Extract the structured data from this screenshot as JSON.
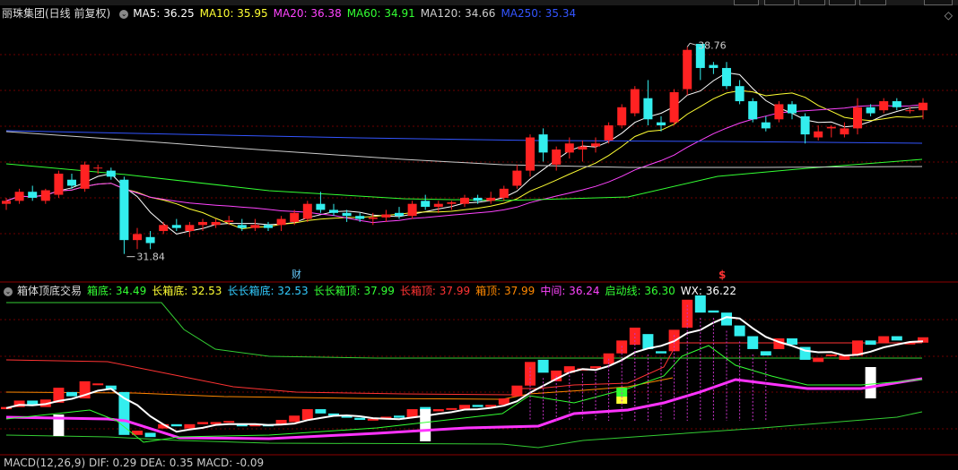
{
  "title": "丽珠集团(日线 前复权)",
  "ma_legend": [
    {
      "label": "MA5:",
      "value": "36.25",
      "color": "#ffffff"
    },
    {
      "label": "MA10:",
      "value": "35.95",
      "color": "#ffff33"
    },
    {
      "label": "MA20:",
      "value": "36.38",
      "color": "#ff44ff"
    },
    {
      "label": "MA60:",
      "value": "34.91",
      "color": "#33ff33"
    },
    {
      "label": "MA120:",
      "value": "34.66",
      "color": "#cccccc"
    },
    {
      "label": "MA250:",
      "value": "35.34",
      "color": "#3355ff"
    }
  ],
  "high_label": "38.76",
  "low_label": "31.84",
  "event_markers": [
    {
      "text": "财",
      "color": "#66ccff"
    },
    {
      "text": "$",
      "color": "#ff3333"
    }
  ],
  "indicator": {
    "name": "箱体顶底交易",
    "fields": [
      {
        "label": "箱底:",
        "value": "34.49",
        "color": "#33ff33"
      },
      {
        "label": "长箱底:",
        "value": "32.53",
        "color": "#ffff33"
      },
      {
        "label": "长长箱底:",
        "value": "32.53",
        "color": "#33ccff"
      },
      {
        "label": "长长箱顶:",
        "value": "37.99",
        "color": "#33ff33"
      },
      {
        "label": "长箱顶:",
        "value": "37.99",
        "color": "#ff3333"
      },
      {
        "label": "箱顶:",
        "value": "37.99",
        "color": "#ff8800"
      },
      {
        "label": "中间:",
        "value": "36.24",
        "color": "#ff44ff"
      },
      {
        "label": "启动线:",
        "value": "36.30",
        "color": "#33ff33"
      },
      {
        "label": "WX:",
        "value": "36.22",
        "color": "#ffffff"
      }
    ]
  },
  "macd_legend": "MACD(12,26,9) DIF: 0.29 DEA: 0.35 MACD: -0.09",
  "colors": {
    "up": "#ff2222",
    "down": "#33eeee",
    "divider": "#8b0000"
  },
  "chart_data": {
    "type": "candlestick",
    "y_range": [
      31.0,
      39.6
    ],
    "candles": [
      [
        33.5,
        33.7,
        33.3,
        33.6
      ],
      [
        33.6,
        34.0,
        33.5,
        33.9
      ],
      [
        33.9,
        34.1,
        33.6,
        33.7
      ],
      [
        33.6,
        34.0,
        33.5,
        33.95
      ],
      [
        33.8,
        34.6,
        33.7,
        34.5
      ],
      [
        34.3,
        34.5,
        34.0,
        34.1
      ],
      [
        34.0,
        34.9,
        33.9,
        34.8
      ],
      [
        34.7,
        34.8,
        34.5,
        34.7
      ],
      [
        34.6,
        34.7,
        34.3,
        34.4
      ],
      [
        34.3,
        34.4,
        31.84,
        32.3
      ],
      [
        32.3,
        32.7,
        32.0,
        32.5
      ],
      [
        32.4,
        32.6,
        32.0,
        32.2
      ],
      [
        32.6,
        32.9,
        32.5,
        32.8
      ],
      [
        32.8,
        33.0,
        32.6,
        32.7
      ],
      [
        32.6,
        32.9,
        32.4,
        32.8
      ],
      [
        32.8,
        33.0,
        32.6,
        32.9
      ],
      [
        32.8,
        33.0,
        32.7,
        32.9
      ],
      [
        32.9,
        33.1,
        32.8,
        32.95
      ],
      [
        32.8,
        33.0,
        32.6,
        32.7
      ],
      [
        32.7,
        33.0,
        32.6,
        32.8
      ],
      [
        32.8,
        32.9,
        32.6,
        32.7
      ],
      [
        32.8,
        33.1,
        32.6,
        33.0
      ],
      [
        32.9,
        33.3,
        32.8,
        33.2
      ],
      [
        33.0,
        33.6,
        32.9,
        33.5
      ],
      [
        33.5,
        33.9,
        33.2,
        33.3
      ],
      [
        33.3,
        33.5,
        33.1,
        33.2
      ],
      [
        33.2,
        33.3,
        32.9,
        33.1
      ],
      [
        33.1,
        33.2,
        32.9,
        33.0
      ],
      [
        33.0,
        33.2,
        32.8,
        33.05
      ],
      [
        33.05,
        33.3,
        32.9,
        33.15
      ],
      [
        33.2,
        33.4,
        33.0,
        33.1
      ],
      [
        33.1,
        33.6,
        33.0,
        33.5
      ],
      [
        33.6,
        33.8,
        33.3,
        33.4
      ],
      [
        33.4,
        33.6,
        33.2,
        33.5
      ],
      [
        33.5,
        33.6,
        33.3,
        33.55
      ],
      [
        33.5,
        33.8,
        33.4,
        33.7
      ],
      [
        33.7,
        33.8,
        33.5,
        33.6
      ],
      [
        33.6,
        33.9,
        33.5,
        33.7
      ],
      [
        33.7,
        34.1,
        33.6,
        34.0
      ],
      [
        34.1,
        34.8,
        34.0,
        34.6
      ],
      [
        34.6,
        35.8,
        34.4,
        35.7
      ],
      [
        35.8,
        36.0,
        34.9,
        35.2
      ],
      [
        34.8,
        35.4,
        34.6,
        35.3
      ],
      [
        35.2,
        35.7,
        35.0,
        35.5
      ],
      [
        35.3,
        35.6,
        34.9,
        35.4
      ],
      [
        35.4,
        35.7,
        35.2,
        35.5
      ],
      [
        35.6,
        36.2,
        35.5,
        36.1
      ],
      [
        36.1,
        36.8,
        36.0,
        36.7
      ],
      [
        36.5,
        37.4,
        36.4,
        37.3
      ],
      [
        37.0,
        37.6,
        36.1,
        36.3
      ],
      [
        36.2,
        36.4,
        35.9,
        36.1
      ],
      [
        36.2,
        37.3,
        36.1,
        37.2
      ],
      [
        37.3,
        38.7,
        37.1,
        38.6
      ],
      [
        38.8,
        38.76,
        37.6,
        38.0
      ],
      [
        38.1,
        38.2,
        37.8,
        38.0
      ],
      [
        38.0,
        38.2,
        37.3,
        37.4
      ],
      [
        37.4,
        37.6,
        36.8,
        36.9
      ],
      [
        36.9,
        37.0,
        36.2,
        36.3
      ],
      [
        36.2,
        36.4,
        35.9,
        36.0
      ],
      [
        36.3,
        36.9,
        36.2,
        36.8
      ],
      [
        36.8,
        36.9,
        36.3,
        36.5
      ],
      [
        36.4,
        36.5,
        35.5,
        35.8
      ],
      [
        35.7,
        36.1,
        35.6,
        35.9
      ],
      [
        36.0,
        36.1,
        35.7,
        36.05
      ],
      [
        35.8,
        36.2,
        35.7,
        36.0
      ],
      [
        36.0,
        37.0,
        35.8,
        36.7
      ],
      [
        36.7,
        36.8,
        36.4,
        36.5
      ],
      [
        36.6,
        37.0,
        36.5,
        36.9
      ],
      [
        36.9,
        37.0,
        36.6,
        36.7
      ],
      [
        36.6,
        36.7,
        36.5,
        36.6
      ],
      [
        36.6,
        37.0,
        36.3,
        36.85
      ]
    ]
  }
}
